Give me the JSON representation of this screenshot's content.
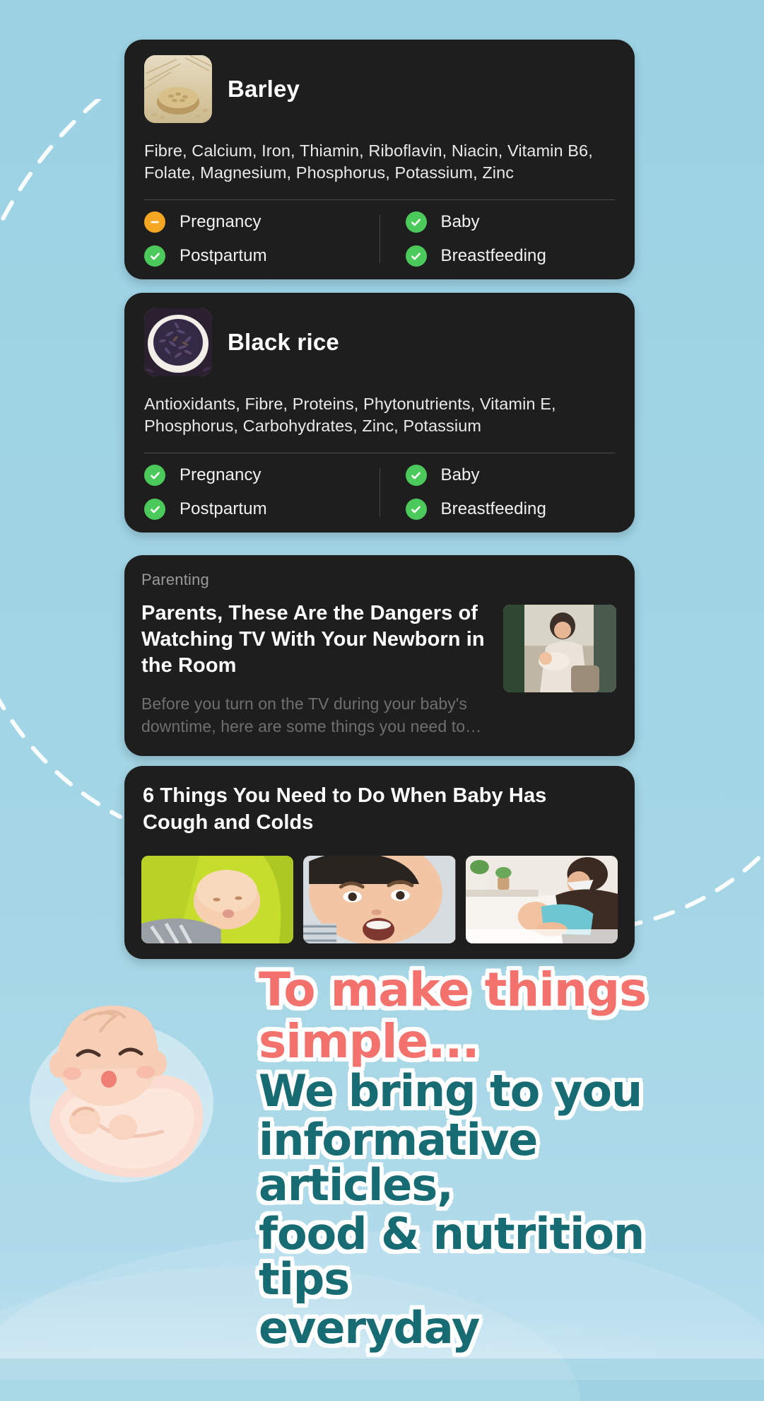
{
  "theme": {
    "background": "#9fd3e3",
    "card_background": "#1e1e1e",
    "ok_color": "#4bc95a",
    "warn_color": "#f5a623",
    "accent_coral": "#f4726e",
    "accent_teal": "#176b72"
  },
  "food_cards": [
    {
      "name": "Barley",
      "thumb_icon": "barley-bowl-photo",
      "nutrients": "Fibre, Calcium, Iron, Thiamin, Riboflavin, Niacin, Vitamin B6, Folate, Magnesium, Phosphorus, Potassium, Zinc",
      "statuses": [
        {
          "label": "Pregnancy",
          "state": "warn",
          "icon": "minus-icon"
        },
        {
          "label": "Baby",
          "state": "ok",
          "icon": "check-icon"
        },
        {
          "label": "Postpartum",
          "state": "ok",
          "icon": "check-icon"
        },
        {
          "label": "Breastfeeding",
          "state": "ok",
          "icon": "check-icon"
        }
      ]
    },
    {
      "name": "Black rice",
      "thumb_icon": "black-rice-bowl-photo",
      "nutrients": "Antioxidants, Fibre, Proteins, Phytonutrients, Vitamin E, Phosphorus, Carbohydrates, Zinc, Potassium",
      "statuses": [
        {
          "label": "Pregnancy",
          "state": "ok",
          "icon": "check-icon"
        },
        {
          "label": "Baby",
          "state": "ok",
          "icon": "check-icon"
        },
        {
          "label": "Postpartum",
          "state": "ok",
          "icon": "check-icon"
        },
        {
          "label": "Breastfeeding",
          "state": "ok",
          "icon": "check-icon"
        }
      ]
    }
  ],
  "article_card": {
    "category": "Parenting",
    "title": "Parents, These Are the Dangers of Watching TV With Your Newborn in the Room",
    "description": "Before you turn on the TV during your baby's downtime, here are some things you need to…",
    "thumb_icon": "mother-and-baby-on-sofa-photo"
  },
  "gallery_card": {
    "title": "6 Things You Need to Do When Baby Has Cough and Colds",
    "images": [
      {
        "icon": "sleeping-baby-on-green-blanket-photo"
      },
      {
        "icon": "crying-baby-closeup-photo"
      },
      {
        "icon": "mother-caring-for-baby-photo"
      }
    ]
  },
  "promo": {
    "line1": "To make things",
    "line2": "simple...",
    "line3": "We bring to you",
    "line4": "informative articles,",
    "line5": "food & nutrition tips",
    "line6": "everyday"
  },
  "decorations": {
    "baby_illustration": "swaddled-sleeping-baby-illustration",
    "dashed_arc_left": "dashed-arc-decoration",
    "dashed_arc_right": "dashed-arc-decoration",
    "dashed_arc_small": "dashed-arc-decoration"
  }
}
